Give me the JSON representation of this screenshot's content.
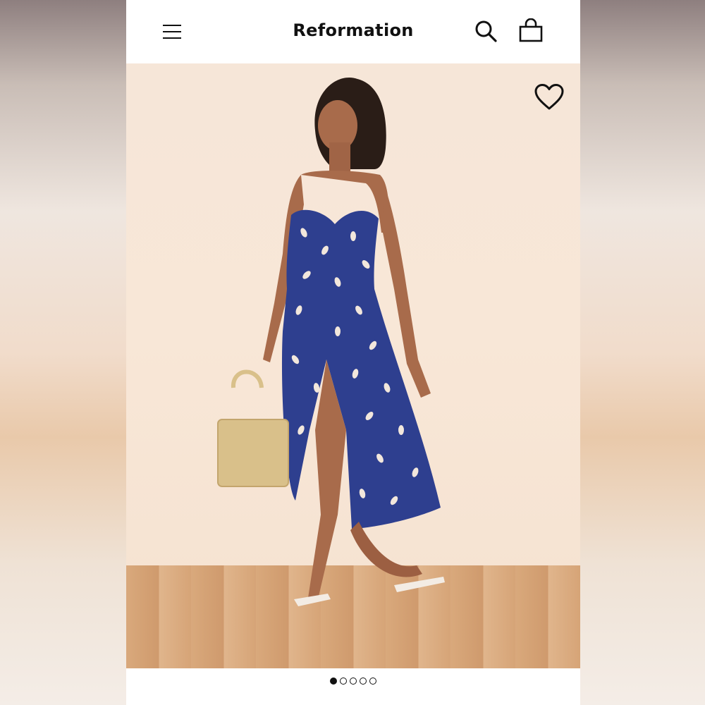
{
  "header": {
    "brand": "Reformation",
    "icons": {
      "menu": "hamburger-menu-icon",
      "search": "search-icon",
      "bag": "shopping-bag-icon"
    }
  },
  "product_image": {
    "description_icons": {
      "favorite": "heart-outline-icon"
    },
    "dress_color": "#2e3f8f",
    "dot_color": "#f2e7dc"
  },
  "carousel": {
    "total": 5,
    "active_index": 0
  },
  "colors": {
    "page_background": "#ffffff",
    "text": "#111111",
    "wall": "#f6e6d8",
    "floor": "#d6a477"
  }
}
